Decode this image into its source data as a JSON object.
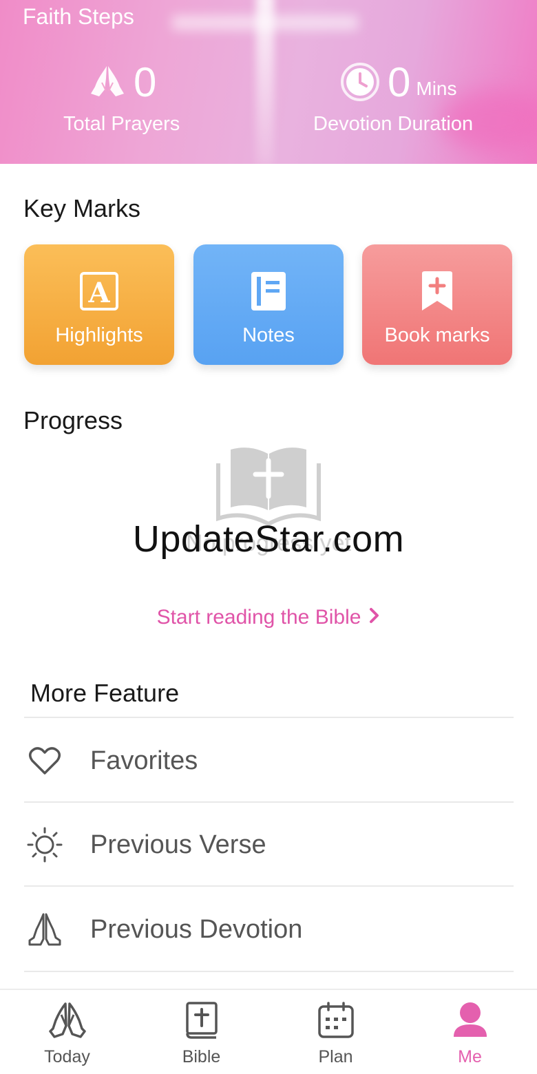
{
  "header": {
    "app_title": "Faith Steps",
    "prayers": {
      "value": "0",
      "label": "Total Prayers",
      "icon": "praying-hands-icon"
    },
    "duration": {
      "value": "0",
      "unit": "Mins",
      "label": "Devotion Duration",
      "icon": "clock-icon"
    }
  },
  "key_marks": {
    "title": "Key Marks",
    "cards": [
      {
        "label": "Highlights",
        "icon": "highlight-icon",
        "color": "#f5a93e"
      },
      {
        "label": "Notes",
        "icon": "note-icon",
        "color": "#5fa7f4"
      },
      {
        "label": "Book marks",
        "icon": "bookmark-icon",
        "color": "#f27f7f"
      }
    ]
  },
  "progress": {
    "title": "Progress",
    "empty_text": "No progress yet",
    "watermark": "UpdateStar.com",
    "cta": "Start reading the Bible"
  },
  "more": {
    "title": "More Feature",
    "items": [
      {
        "label": "Favorites",
        "icon": "heart-icon"
      },
      {
        "label": "Previous Verse",
        "icon": "sun-icon"
      },
      {
        "label": "Previous Devotion",
        "icon": "praying-hands-icon"
      }
    ]
  },
  "nav": {
    "items": [
      {
        "label": "Today",
        "icon": "praying-hands-icon"
      },
      {
        "label": "Bible",
        "icon": "bible-icon"
      },
      {
        "label": "Plan",
        "icon": "calendar-icon"
      },
      {
        "label": "Me",
        "icon": "person-icon"
      }
    ],
    "active_color": "#e460ae"
  }
}
